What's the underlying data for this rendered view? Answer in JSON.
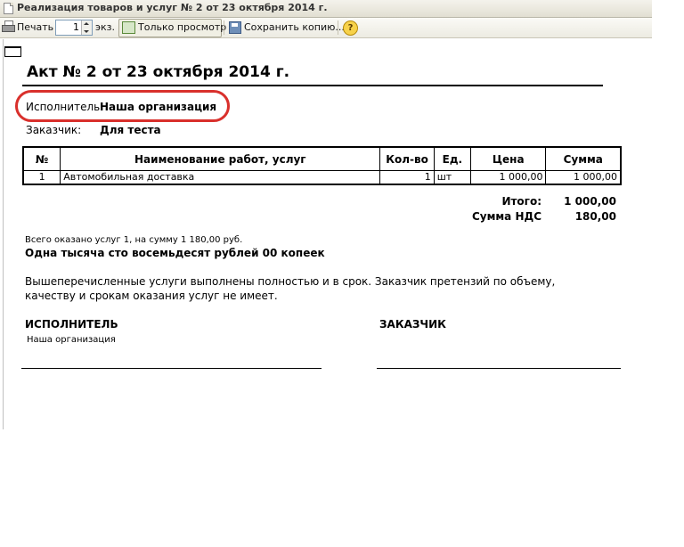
{
  "window": {
    "title": "Реализация товаров и услуг № 2 от 23 октября 2014 г."
  },
  "toolbar": {
    "print_label": "Печать",
    "copies_value": "1",
    "copies_unit": "экз.",
    "view_only_label": "Только просмотр",
    "save_copy_label": "Сохранить копию...",
    "help_glyph": "?"
  },
  "document": {
    "title": "Акт № 2 от 23 октября 2014 г.",
    "performer_label": "Исполнитель:",
    "performer_value": "Наша организация",
    "customer_label": "Заказчик:",
    "customer_value": "Для теста",
    "table": {
      "headers": [
        "№",
        "Наименование работ, услуг",
        "Кол-во",
        "Ед.",
        "Цена",
        "Сумма"
      ],
      "rows": [
        [
          "1",
          "Автомобильная доставка",
          "1",
          "шт",
          "1 000,00",
          "1 000,00"
        ]
      ]
    },
    "totals": {
      "total_label": "Итого:",
      "total_value": "1 000,00",
      "vat_label": "Сумма НДС",
      "vat_value": "180,00"
    },
    "summary_small": "Всего оказано услуг 1, на сумму 1 180,00 руб.",
    "summary_words": "Одна тысяча сто восемьдесят рублей 00 копеек",
    "statement": "Вышеперечисленные услуги выполнены полностью и в срок. Заказчик претензий по объему, качеству и срокам оказания услуг не имеет.",
    "signatures": {
      "performer_heading": "ИСПОЛНИТЕЛЬ",
      "performer_name": "Наша организация",
      "customer_heading": "ЗАКАЗЧИК"
    }
  },
  "colors": {
    "highlight_oval": "#d9302c"
  }
}
